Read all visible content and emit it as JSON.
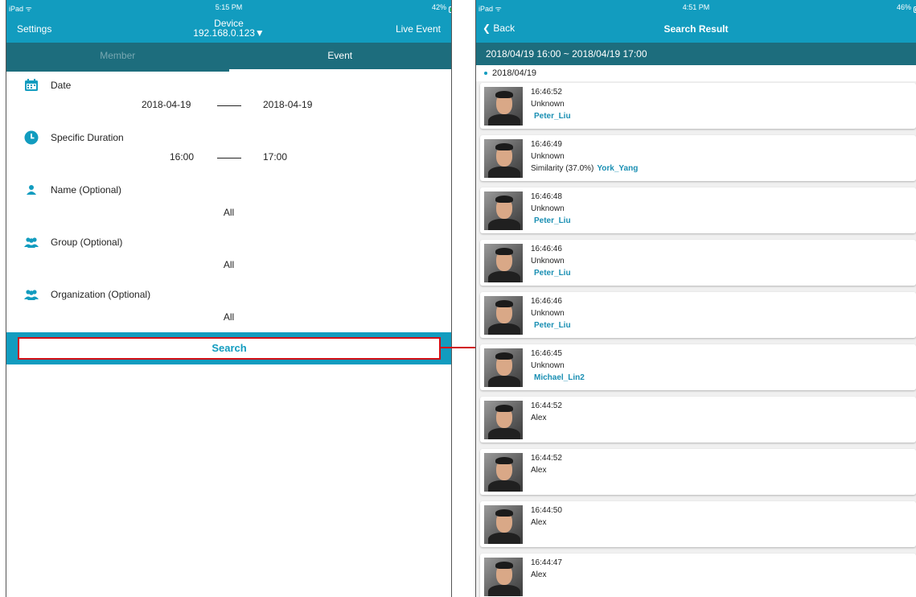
{
  "left": {
    "status": {
      "left": "iPad ᯤ",
      "time": "5:15 PM",
      "battery": "42%",
      "battery_level": 0.42
    },
    "nav": {
      "left": "Settings",
      "title": "Device",
      "subtitle": "192.168.0.123▼",
      "right": "Live Event"
    },
    "tabs": [
      {
        "label": "Member"
      },
      {
        "label": "Event"
      }
    ],
    "fields": {
      "date": {
        "label": "Date",
        "from": "2018-04-19",
        "to": "2018-04-19"
      },
      "duration": {
        "label": "Specific Duration",
        "from": "16:00",
        "to": "17:00"
      },
      "name": {
        "label": "Name (Optional)",
        "value": "All"
      },
      "group": {
        "label": "Group (Optional)",
        "value": "All"
      },
      "organization": {
        "label": "Organization (Optional)",
        "value": "All"
      }
    },
    "search_label": "Search"
  },
  "right": {
    "status": {
      "left": "iPad ᯤ",
      "time": "4:51 PM",
      "battery": "46%",
      "battery_level": 0.46
    },
    "nav": {
      "back": "❮ Back",
      "title": "Search Result"
    },
    "range": "2018/04/19 16:00 ~ 2018/04/19 17:00",
    "date_group": "2018/04/19",
    "results": [
      {
        "time": "16:46:52",
        "status": "Unknown",
        "prefix": "",
        "name": "Peter_Liu"
      },
      {
        "time": "16:46:49",
        "status": "Unknown",
        "prefix": "Similarity (37.0%)",
        "name": "York_Yang"
      },
      {
        "time": "16:46:48",
        "status": "Unknown",
        "prefix": "",
        "name": "Peter_Liu"
      },
      {
        "time": "16:46:46",
        "status": "Unknown",
        "prefix": "",
        "name": "Peter_Liu"
      },
      {
        "time": "16:46:46",
        "status": "Unknown",
        "prefix": "",
        "name": "Peter_Liu"
      },
      {
        "time": "16:46:45",
        "status": "Unknown",
        "prefix": "",
        "name": "Michael_Lin2"
      },
      {
        "time": "16:44:52",
        "status": "Alex",
        "prefix": "",
        "name": ""
      },
      {
        "time": "16:44:52",
        "status": "Alex",
        "prefix": "",
        "name": ""
      },
      {
        "time": "16:44:50",
        "status": "Alex",
        "prefix": "",
        "name": ""
      },
      {
        "time": "16:44:47",
        "status": "Alex",
        "prefix": "",
        "name": ""
      }
    ]
  },
  "colors": {
    "accent": "#129cbf",
    "dark_bar": "#1d6d7d",
    "highlight": "#d10f16",
    "name_link": "#1a8fb3"
  }
}
